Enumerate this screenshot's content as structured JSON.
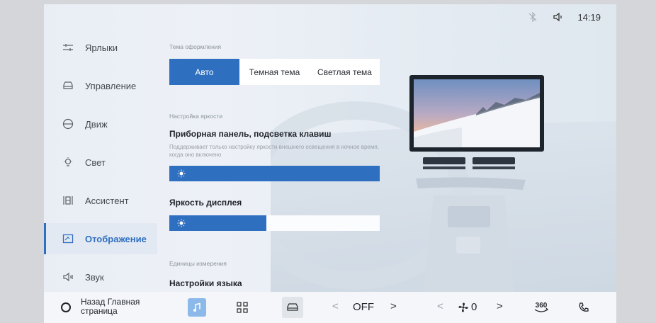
{
  "status_bar": {
    "time": "14:19",
    "icons": [
      "bluetooth-off-icon",
      "volume-icon"
    ]
  },
  "sidebar": {
    "items": [
      {
        "label": "Ярлыки",
        "icon": "shortcuts-icon",
        "active": false
      },
      {
        "label": "Управление",
        "icon": "car-control-icon",
        "active": false
      },
      {
        "label": "Движ",
        "icon": "steering-wheel-icon",
        "active": false
      },
      {
        "label": "Свет",
        "icon": "light-icon",
        "active": false
      },
      {
        "label": "Ассистент",
        "icon": "assistant-icon",
        "active": false
      },
      {
        "label": "Отображение",
        "icon": "display-icon",
        "active": true
      },
      {
        "label": "Звук",
        "icon": "sound-icon",
        "active": false
      }
    ]
  },
  "main": {
    "theme": {
      "label": "Тема оформления",
      "options": [
        "Авто",
        "Темная тема",
        "Светлая тема"
      ],
      "selected": "Авто"
    },
    "brightness": {
      "label": "Настройка яркости",
      "panel_title": "Приборная панель, подсветка клавиш",
      "panel_desc": "Поддерживает только настройку яркости внешнего освещения в ночное время, когда оно включено",
      "panel_level": 1.0,
      "display_title": "Яркость дисплея",
      "display_level": 0.46
    },
    "units_label": "Единицы измерения",
    "language_title": "Настройки языка"
  },
  "dock": {
    "home_label": "Назад Главная страница",
    "temperature": "OFF",
    "fan_level": "0",
    "camera_label": "360",
    "icons": [
      "music-icon",
      "apps-grid-icon",
      "car-icon",
      "fan-icon",
      "camera-360-icon",
      "phone-icon"
    ]
  },
  "colors": {
    "accent": "#2f6fc0",
    "background": "#e9eef5",
    "dock": "#f4f6f9"
  }
}
